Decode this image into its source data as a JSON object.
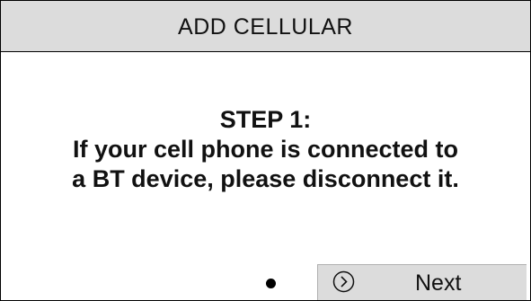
{
  "header": {
    "title": "ADD CELLULAR"
  },
  "body": {
    "step": "STEP 1:",
    "lines": [
      "If your cell phone is connected to",
      "a BT device, please disconnect it."
    ]
  },
  "footer": {
    "page_indicator": {
      "current_page": 1,
      "total_pages": 1
    },
    "next_button": {
      "icon": "chevron-right-circle-icon",
      "label": "Next"
    }
  },
  "colors": {
    "title_bar": "#dcdcdc",
    "button": "#dcdcdc",
    "text": "#111111",
    "background": "#ffffff"
  }
}
